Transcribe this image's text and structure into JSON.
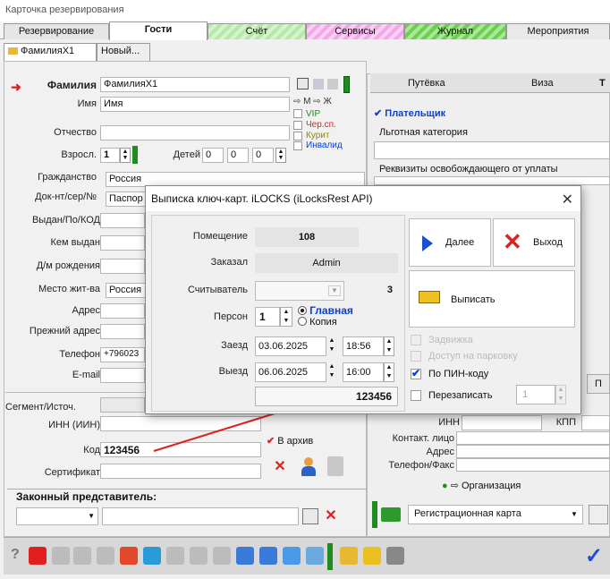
{
  "window": {
    "title": "Карточка резервирования"
  },
  "tabs": [
    "Резервирование",
    "Гости",
    "Счёт",
    "Сервисы",
    "Журнал",
    "Мероприятия"
  ],
  "subtabs": [
    "ФамилияX1",
    "Новый..."
  ],
  "guest": {
    "surname_label": "Фамилия",
    "surname": "ФамилияX1",
    "name_label": "Имя",
    "name": "Имя",
    "patronymic_label": "Отчество",
    "patronymic": "",
    "adults_label": "Взросл.",
    "adults": "1",
    "children_label": "Детей",
    "children": [
      "0",
      "0",
      "0"
    ],
    "citizenship_label": "Гражданство",
    "citizenship": "Россия",
    "doc_label": "Док-нт/сер/№",
    "doc": "Паспор",
    "issued_label": "Выдан/По/КОД",
    "issued_by_label": "Кем выдан",
    "birth_label": "Д/м рождения",
    "residence_label": "Место жит-ва",
    "residence": "Россия",
    "address_label": "Адрес",
    "prev_address_label": "Прежний адрес",
    "phone_label": "Телефон",
    "phone": "+796023",
    "email_label": "E-mail",
    "segment_label": "Сегмент/Источ.",
    "inn_label": "ИНН (ИИН)",
    "code_label": "Код",
    "code": "123456",
    "certificate_label": "Сертификат",
    "legal_rep_label": "Законный представитель:",
    "archive_label": "В архив",
    "gender": {
      "m": "М",
      "f": "Ж"
    },
    "flags": [
      "VIP",
      "Чер.сп.",
      "Курит",
      "Инвалид"
    ]
  },
  "right": {
    "tabs": [
      "Путёвка",
      "Виза",
      "Т"
    ],
    "payer_label": "Плательщик",
    "benefit_label": "Льготная категория",
    "exempt_label": "Реквизиты освобождающего от уплаты",
    "inn_label": "ИНН",
    "kpp_label": "КПП",
    "contact_label": "Контакт. лицо",
    "address_label": "Адрес",
    "phone_fax_label": "Телефон/Факс",
    "org_label": "Организация",
    "p_tab": "П",
    "reg_card": "Регистрационная карта"
  },
  "dialog": {
    "title": "Выписка ключ-карт. iLOCKS (iLocksRest API)",
    "room_label": "Помещение",
    "room": "108",
    "ordered_label": "Заказал",
    "ordered": "Admin",
    "reader_label": "Считыватель",
    "reader_num": "3",
    "persons_label": "Персон",
    "persons": "1",
    "main_label": "Главная",
    "copy_label": "Копия",
    "checkin_label": "Заезд",
    "checkin_date": "03.06.2025",
    "checkin_time": "18:56",
    "checkout_label": "Выезд",
    "checkout_date": "06.06.2025",
    "checkout_time": "16:00",
    "pin": "123456",
    "next_label": "Далее",
    "exit_label": "Выход",
    "issue_label": "Выписать",
    "opt1": "Задвижка",
    "opt2": "Доступ на парковку",
    "pin_code_label": "По ПИН-коду",
    "rewrite_label": "Перезаписать",
    "rewrite_count": "1"
  },
  "colors": {
    "accent": "#0a3fd8",
    "red": "#e02020",
    "green": "#2d9a2d"
  }
}
